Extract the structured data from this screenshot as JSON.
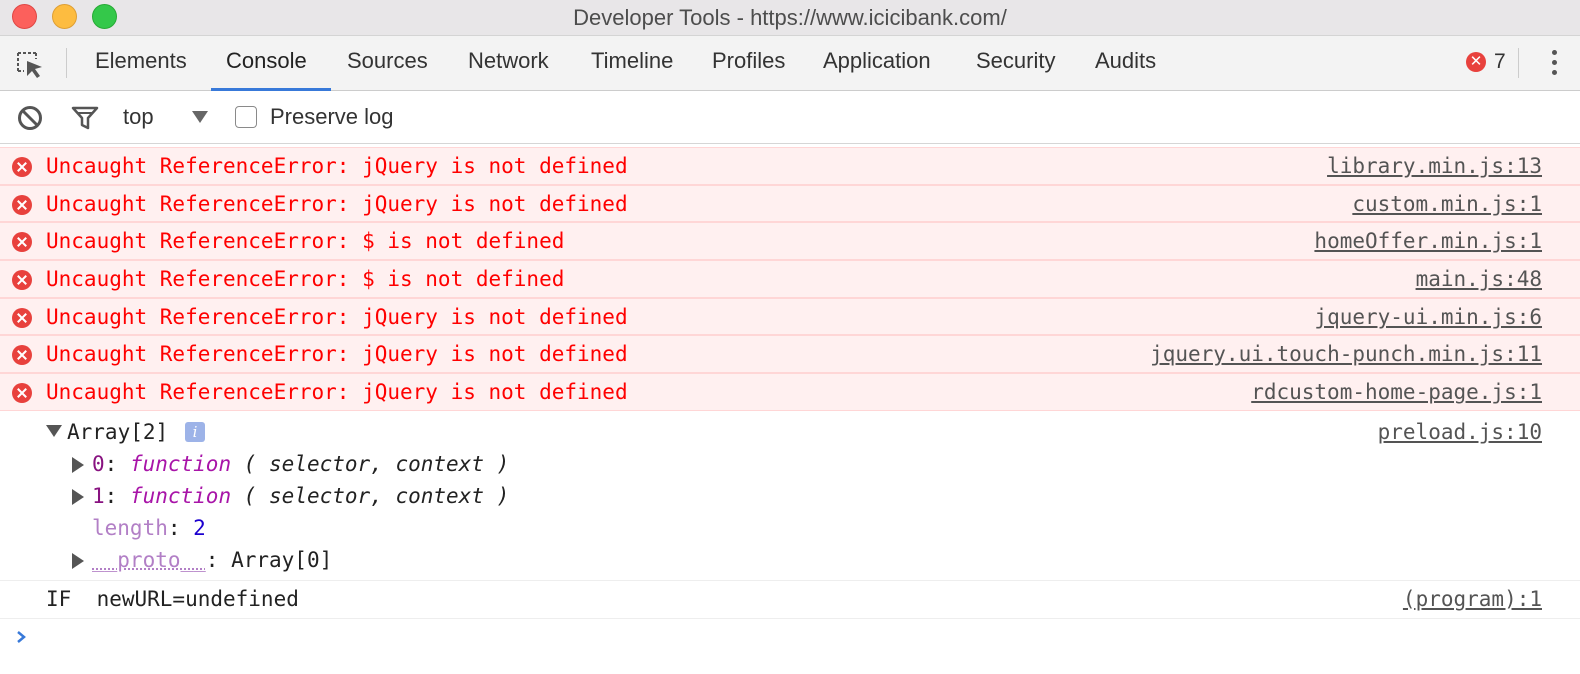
{
  "window": {
    "title": "Developer Tools - https://www.icicibank.com/"
  },
  "tabs": [
    {
      "label": "Elements"
    },
    {
      "label": "Console"
    },
    {
      "label": "Sources"
    },
    {
      "label": "Network"
    },
    {
      "label": "Timeline"
    },
    {
      "label": "Profiles"
    },
    {
      "label": "Application"
    },
    {
      "label": "Security"
    },
    {
      "label": "Audits"
    }
  ],
  "active_tab": "Console",
  "error_count": "7",
  "toolbar": {
    "context": "top",
    "preserve_log_label": "Preserve log",
    "preserve_log_checked": false
  },
  "messages": {
    "errors": [
      {
        "text": "Uncaught ReferenceError: jQuery is not defined",
        "source": "library.min.js:13"
      },
      {
        "text": "Uncaught ReferenceError: jQuery is not defined",
        "source": "custom.min.js:1"
      },
      {
        "text": "Uncaught ReferenceError: $ is not defined",
        "source": "homeOffer.min.js:1"
      },
      {
        "text": "Uncaught ReferenceError: $ is not defined",
        "source": "main.js:48"
      },
      {
        "text": "Uncaught ReferenceError: jQuery is not defined",
        "source": "jquery-ui.min.js:6"
      },
      {
        "text": "Uncaught ReferenceError: jQuery is not defined",
        "source": "jquery.ui.touch-punch.min.js:11"
      },
      {
        "text": "Uncaught ReferenceError: jQuery is not defined",
        "source": "rdcustom-home-page.js:1"
      }
    ],
    "array_log": {
      "label": "Array[2]",
      "info": "i",
      "source": "preload.js:10",
      "items": [
        {
          "key": "0",
          "colon": ": ",
          "keyword": "function",
          "args": " ( selector, context )"
        },
        {
          "key": "1",
          "colon": ": ",
          "keyword": "function",
          "args": " ( selector, context )"
        }
      ],
      "length_key": "length",
      "length_value": "2",
      "proto_key": "__proto__",
      "proto_value": "Array[0]"
    },
    "if_log": {
      "text": "IF  newURL=undefined",
      "source": "(program):1"
    }
  },
  "colors": {
    "error_text": "#ff0000",
    "error_bg": "#fff0f0",
    "accent": "#3879d9"
  }
}
